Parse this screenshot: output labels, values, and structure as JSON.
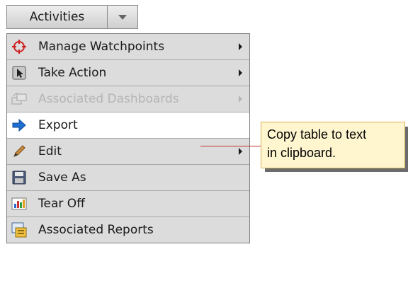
{
  "activities": {
    "label": "Activities"
  },
  "menu": {
    "items": [
      {
        "label": "Manage Watchpoints",
        "icon": "crosshair-icon",
        "submenu": true,
        "disabled": false,
        "selected": false
      },
      {
        "label": "Take Action",
        "icon": "cursor-icon",
        "submenu": true,
        "disabled": false,
        "selected": false
      },
      {
        "label": "Associated Dashboards",
        "icon": "dashboards-icon",
        "submenu": true,
        "disabled": true,
        "selected": false
      },
      {
        "label": "Export",
        "icon": "export-arrow-icon",
        "submenu": false,
        "disabled": false,
        "selected": true
      },
      {
        "label": "Edit",
        "icon": "pencil-icon",
        "submenu": true,
        "disabled": false,
        "selected": false
      },
      {
        "label": "Save As",
        "icon": "floppy-disk-icon",
        "submenu": false,
        "disabled": false,
        "selected": false
      },
      {
        "label": "Tear Off",
        "icon": "tear-off-chart-icon",
        "submenu": false,
        "disabled": false,
        "selected": false
      },
      {
        "label": "Associated Reports",
        "icon": "reports-icon",
        "submenu": false,
        "disabled": false,
        "selected": false
      }
    ]
  },
  "callout": {
    "line1": "Copy table to text",
    "line2": "in clipboard."
  },
  "colors": {
    "accent": "#1f6fd0",
    "callout_bg": "#fff6cf",
    "callout_line": "#c03030",
    "watch_red": "#d02020"
  }
}
